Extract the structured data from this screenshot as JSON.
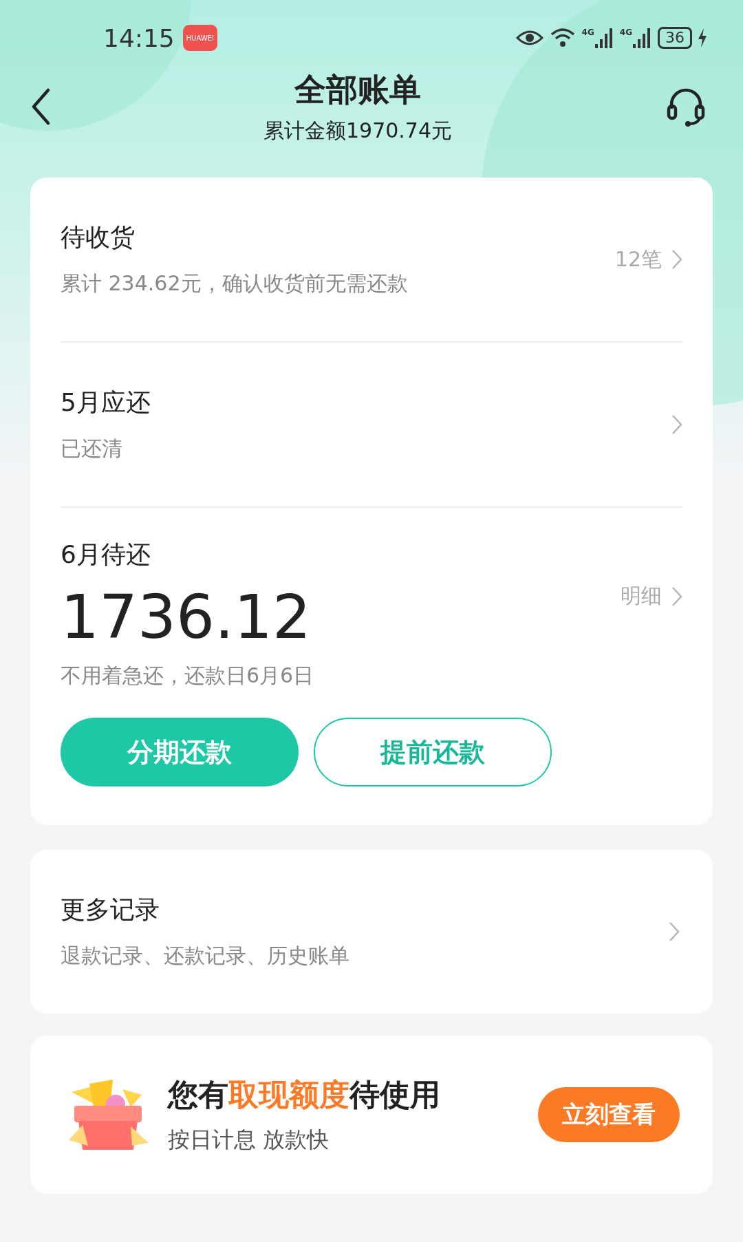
{
  "status_bar": {
    "time": "14:15",
    "app_badge": "HUAWEI",
    "signals": [
      "4G",
      "4G"
    ],
    "battery": "36"
  },
  "header": {
    "title": "全部账单",
    "subtitle": "累计金额1970.74元"
  },
  "bill_card": {
    "sections": [
      {
        "kind": "summary",
        "title": "待收货",
        "subtitle": "累计 234.62元，确认收货前无需还款",
        "side": "12笔"
      },
      {
        "kind": "summary",
        "title": "5月应还",
        "subtitle": "已还清"
      },
      {
        "kind": "due",
        "title": "6月待还",
        "amount": "1736.12",
        "subtitle": "不用着急还，还款日6月6日",
        "side": "明细",
        "buttons": [
          {
            "label": "分期还款",
            "primary": true
          },
          {
            "label": "提前还款",
            "primary": false
          }
        ]
      }
    ]
  },
  "more_card": {
    "title": "更多记录",
    "subtitle": "退款记录、还款记录、历史账单"
  },
  "promo": {
    "title_parts": [
      {
        "text": "您有",
        "highlight": false
      },
      {
        "text": "取现额度",
        "highlight": true
      },
      {
        "text": "待使用",
        "highlight": false
      }
    ],
    "subtitle": "按日计息 放款快",
    "button": "立刻查看"
  }
}
